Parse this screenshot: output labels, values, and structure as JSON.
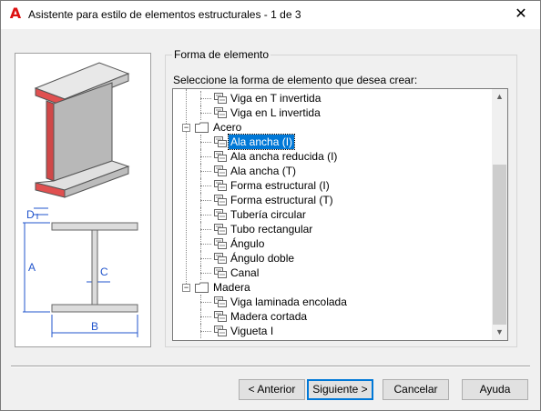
{
  "window": {
    "title": "Asistente para estilo de elementos estructurales - 1 de 3",
    "close_label": "✕",
    "app_icon": "autocad-icon",
    "app_icon_glyph": "A"
  },
  "illustration": {
    "labels": {
      "d": "D",
      "a": "A",
      "c": "C",
      "b": "B"
    }
  },
  "group": {
    "label": "Forma de elemento",
    "prompt": "Seleccione la forma de elemento que desea crear:"
  },
  "tree": {
    "items": [
      {
        "label": "Viga en T invertida",
        "type": "item",
        "level": 1
      },
      {
        "label": "Viga en L invertida",
        "type": "item",
        "level": 1
      },
      {
        "label": "Acero",
        "type": "folder",
        "level": 0,
        "expander": "−"
      },
      {
        "label": "Ala ancha (I)",
        "type": "item",
        "level": 1,
        "selected": true
      },
      {
        "label": "Ala ancha reducida (I)",
        "type": "item",
        "level": 1
      },
      {
        "label": "Ala ancha (T)",
        "type": "item",
        "level": 1
      },
      {
        "label": "Forma estructural (I)",
        "type": "item",
        "level": 1
      },
      {
        "label": "Forma estructural (T)",
        "type": "item",
        "level": 1
      },
      {
        "label": "Tubería circular",
        "type": "item",
        "level": 1
      },
      {
        "label": "Tubo rectangular",
        "type": "item",
        "level": 1
      },
      {
        "label": "Ángulo",
        "type": "item",
        "level": 1
      },
      {
        "label": "Ángulo doble",
        "type": "item",
        "level": 1
      },
      {
        "label": "Canal",
        "type": "item",
        "level": 1
      },
      {
        "label": "Madera",
        "type": "folder",
        "level": 0,
        "expander": "−"
      },
      {
        "label": "Viga laminada encolada",
        "type": "item",
        "level": 1
      },
      {
        "label": "Madera cortada",
        "type": "item",
        "level": 1
      },
      {
        "label": "Vigueta I",
        "type": "item",
        "level": 1
      }
    ],
    "scroll_up": "▲",
    "scroll_down": "▼"
  },
  "buttons": {
    "back": "< Anterior",
    "next": "Siguiente >",
    "cancel": "Cancelar",
    "help": "Ayuda"
  },
  "colors": {
    "accent": "#0078d7",
    "flange_red": "#e05050"
  }
}
